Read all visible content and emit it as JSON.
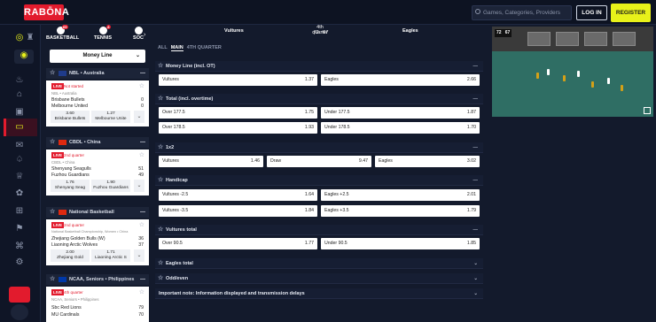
{
  "header": {
    "logo": "RABŌNA",
    "search_placeholder": "Games, Categories, Providers",
    "login": "LOG IN",
    "register": "REGISTER"
  },
  "sports": [
    {
      "label": "BASKETBALL",
      "count": "65"
    },
    {
      "label": "TENNIS",
      "count": "8"
    },
    {
      "label": "SOC",
      "count": ""
    }
  ],
  "market_select": "Money Line",
  "leagues": [
    {
      "name": "NBL • Australia",
      "status": "Not started",
      "sub": "NBL • Australia",
      "home": "Brisbane Bullets",
      "away": "Melbourne United",
      "hs": "0",
      "as": "0",
      "o1v": "3.60",
      "o1t": "Brisbane Bullets",
      "o2v": "1.27",
      "o2t": "Melbourne Unite"
    },
    {
      "name": "CBDL • China",
      "status": "2nd quarter",
      "sub": "CBDL • China",
      "home": "Shenyang Seagulls",
      "away": "Fuzhou Guardians",
      "hs": "51",
      "as": "49",
      "o1v": "1.76",
      "o1t": "Shenyang Seag",
      "o2v": "1.90",
      "o2t": "Fuzhou Guardians"
    },
    {
      "name": "National Basketball Championship",
      "status": "2nd quarter",
      "sub": "National Basketball Championship, Women • China",
      "home": "Zhejiang Golden Bulls (W)",
      "away": "Liaoning Arctic Wolves",
      "hs": "36",
      "as": "37",
      "o1v": "2.00",
      "o1t": "Zhejiang Gold",
      "o2v": "1.71",
      "o2t": "Liaoning Arctic S"
    },
    {
      "name": "NCAA, Seniors • Philippines",
      "status": "4th quarter",
      "sub": "NCAA, Seniors • Philippines",
      "home": "Sbc Red Lions",
      "away": "MU Cardinals",
      "hs": "79",
      "as": "70",
      "o1v": "",
      "o1t": "",
      "o2v": "",
      "o2t": ""
    }
  ],
  "match": {
    "home": "Vultures",
    "away": "Eagles",
    "period": "4th quarter",
    "clock": "72 : 67"
  },
  "tabs": [
    "ALL",
    "MAIN",
    "4TH QUARTER"
  ],
  "markets": {
    "money_line": {
      "title": "Money Line (incl. OT)",
      "a": "Vultures",
      "av": "1.37",
      "b": "Eagles",
      "bv": "2.66"
    },
    "total": {
      "title": "Total (incl. overtime)",
      "r1a": "Over 177.5",
      "r1av": "1.75",
      "r1b": "Under 177.5",
      "r1bv": "1.87",
      "r2a": "Over 178.5",
      "r2av": "1.93",
      "r2b": "Under 178.5",
      "r2bv": "1.70"
    },
    "x12": {
      "title": "1x2",
      "a": "Vultures",
      "av": "1.46",
      "b": "Draw",
      "bv": "9.47",
      "c": "Eagles",
      "cv": "3.02"
    },
    "handicap": {
      "title": "Handicap",
      "r1a": "Vultures -2.5",
      "r1av": "1.64",
      "r1b": "Eagles +2.5",
      "r1bv": "2.01",
      "r2a": "Vultures -3.5",
      "r2av": "1.84",
      "r2b": "Eagles +3.5",
      "r2bv": "1.79"
    },
    "vtotal": {
      "title": "Vultures total",
      "a": "Over 90.5",
      "av": "1.77",
      "b": "Under 90.5",
      "bv": "1.85"
    },
    "etotal": "Eagles total",
    "oddeven": "Odd/even",
    "note": "Important note: Information displayed and transmission delays"
  },
  "video": {
    "home_score": "72",
    "away_score": "67"
  }
}
